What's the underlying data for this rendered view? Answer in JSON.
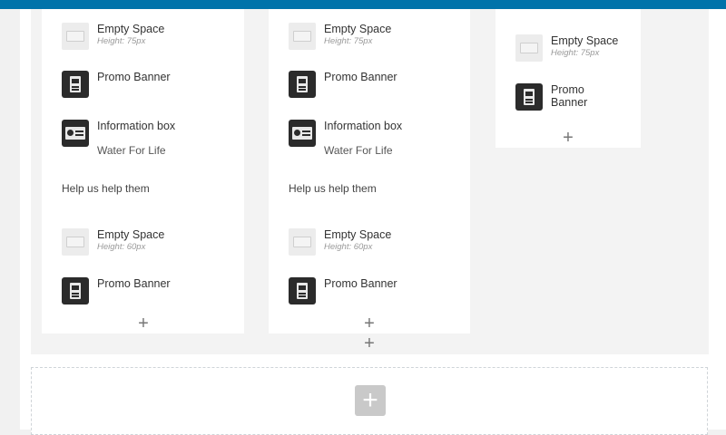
{
  "theme": {
    "accent": "#0073aa"
  },
  "columns": [
    {
      "elements": [
        {
          "type": "empty-space",
          "title": "Empty Space",
          "subtitle": "Height: 75px"
        },
        {
          "type": "promo-banner",
          "title": "Promo Banner"
        },
        {
          "type": "information-box",
          "title": "Information box",
          "subtitle": "Water For Life",
          "text": "Help us help them"
        },
        {
          "type": "empty-space",
          "title": "Empty Space",
          "subtitle": "Height: 60px"
        },
        {
          "type": "promo-banner",
          "title": "Promo Banner"
        }
      ],
      "add_label": "+"
    },
    {
      "elements": [
        {
          "type": "empty-space",
          "title": "Empty Space",
          "subtitle": "Height: 75px"
        },
        {
          "type": "promo-banner",
          "title": "Promo Banner"
        },
        {
          "type": "information-box",
          "title": "Information box",
          "subtitle": "Water For Life",
          "text": "Help us help them"
        },
        {
          "type": "empty-space",
          "title": "Empty Space",
          "subtitle": "Height: 60px"
        },
        {
          "type": "promo-banner",
          "title": "Promo Banner"
        }
      ],
      "add_label": "+"
    },
    {
      "elements": [
        {
          "type": "empty-space",
          "title": "Empty Space",
          "subtitle": "Height: 75px"
        },
        {
          "type": "promo-banner",
          "title": "Promo\nBanner"
        }
      ],
      "add_label": "+"
    }
  ],
  "row": {
    "add_label": "+"
  },
  "section": {
    "add_label": "+"
  },
  "icons": {
    "empty_space": "empty-space-icon",
    "promo_banner": "promo-banner-icon",
    "information_box": "information-box-icon",
    "add": "plus-icon"
  }
}
